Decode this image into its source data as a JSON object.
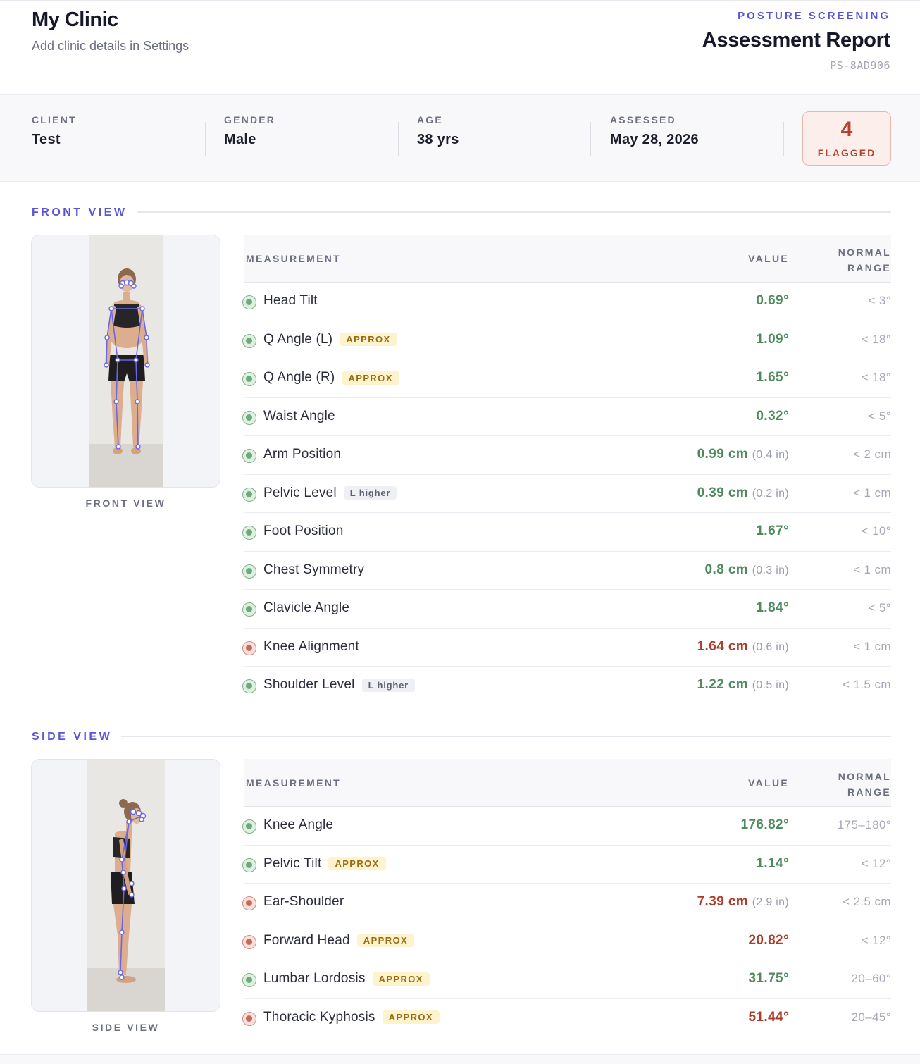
{
  "header": {
    "clinic_name": "My Clinic",
    "clinic_subtitle": "Add clinic details in Settings",
    "kicker": "POSTURE SCREENING",
    "title": "Assessment Report",
    "report_id": "PS-8AD906"
  },
  "client_info": [
    {
      "label": "CLIENT",
      "value": "Test"
    },
    {
      "label": "GENDER",
      "value": "Male"
    },
    {
      "label": "AGE",
      "value": "38 yrs"
    },
    {
      "label": "ASSESSED",
      "value": "May 28, 2026"
    }
  ],
  "flagged": {
    "count": "4",
    "label": "FLAGGED"
  },
  "colors": {
    "accent": "#5a55d6",
    "ok": "#4d8a5c",
    "flag": "#ad3b29",
    "approx_badge_bg": "#fdf3cc"
  },
  "columns": {
    "measurement": "MEASUREMENT",
    "value": "VALUE",
    "range_line1": "NORMAL",
    "range_line2": "RANGE"
  },
  "front": {
    "section_title": "FRONT VIEW",
    "photo_caption": "FRONT VIEW",
    "rows": [
      {
        "name": "Head Tilt",
        "badge": "",
        "badge_type": "",
        "value": "0.69°",
        "imperial": "",
        "range": "< 3°",
        "status": "ok"
      },
      {
        "name": "Q Angle (L)",
        "badge": "APPROX",
        "badge_type": "approx",
        "value": "1.09°",
        "imperial": "",
        "range": "< 18°",
        "status": "ok"
      },
      {
        "name": "Q Angle (R)",
        "badge": "APPROX",
        "badge_type": "approx",
        "value": "1.65°",
        "imperial": "",
        "range": "< 18°",
        "status": "ok"
      },
      {
        "name": "Waist Angle",
        "badge": "",
        "badge_type": "",
        "value": "0.32°",
        "imperial": "",
        "range": "< 5°",
        "status": "ok"
      },
      {
        "name": "Arm Position",
        "badge": "",
        "badge_type": "",
        "value": "0.99 cm",
        "imperial": "(0.4 in)",
        "range": "< 2 cm",
        "status": "ok"
      },
      {
        "name": "Pelvic Level",
        "badge": "L higher",
        "badge_type": "side",
        "value": "0.39 cm",
        "imperial": "(0.2 in)",
        "range": "< 1 cm",
        "status": "ok"
      },
      {
        "name": "Foot Position",
        "badge": "",
        "badge_type": "",
        "value": "1.67°",
        "imperial": "",
        "range": "< 10°",
        "status": "ok"
      },
      {
        "name": "Chest Symmetry",
        "badge": "",
        "badge_type": "",
        "value": "0.8 cm",
        "imperial": "(0.3 in)",
        "range": "< 1 cm",
        "status": "ok"
      },
      {
        "name": "Clavicle Angle",
        "badge": "",
        "badge_type": "",
        "value": "1.84°",
        "imperial": "",
        "range": "< 5°",
        "status": "ok"
      },
      {
        "name": "Knee Alignment",
        "badge": "",
        "badge_type": "",
        "value": "1.64 cm",
        "imperial": "(0.6 in)",
        "range": "< 1 cm",
        "status": "bad"
      },
      {
        "name": "Shoulder Level",
        "badge": "L higher",
        "badge_type": "side",
        "value": "1.22 cm",
        "imperial": "(0.5 in)",
        "range": "< 1.5 cm",
        "status": "ok"
      }
    ]
  },
  "side": {
    "section_title": "SIDE VIEW",
    "photo_caption": "SIDE VIEW",
    "rows": [
      {
        "name": "Knee Angle",
        "badge": "",
        "badge_type": "",
        "value": "176.82°",
        "imperial": "",
        "range": "175–180°",
        "status": "ok"
      },
      {
        "name": "Pelvic Tilt",
        "badge": "APPROX",
        "badge_type": "approx",
        "value": "1.14°",
        "imperial": "",
        "range": "< 12°",
        "status": "ok"
      },
      {
        "name": "Ear-Shoulder",
        "badge": "",
        "badge_type": "",
        "value": "7.39 cm",
        "imperial": "(2.9 in)",
        "range": "< 2.5 cm",
        "status": "bad"
      },
      {
        "name": "Forward Head",
        "badge": "APPROX",
        "badge_type": "approx",
        "value": "20.82°",
        "imperial": "",
        "range": "< 12°",
        "status": "bad"
      },
      {
        "name": "Lumbar Lordosis",
        "badge": "APPROX",
        "badge_type": "approx",
        "value": "31.75°",
        "imperial": "",
        "range": "20–60°",
        "status": "ok"
      },
      {
        "name": "Thoracic Kyphosis",
        "badge": "APPROX",
        "badge_type": "approx",
        "value": "51.44°",
        "imperial": "",
        "range": "20–45°",
        "status": "bad"
      }
    ]
  }
}
